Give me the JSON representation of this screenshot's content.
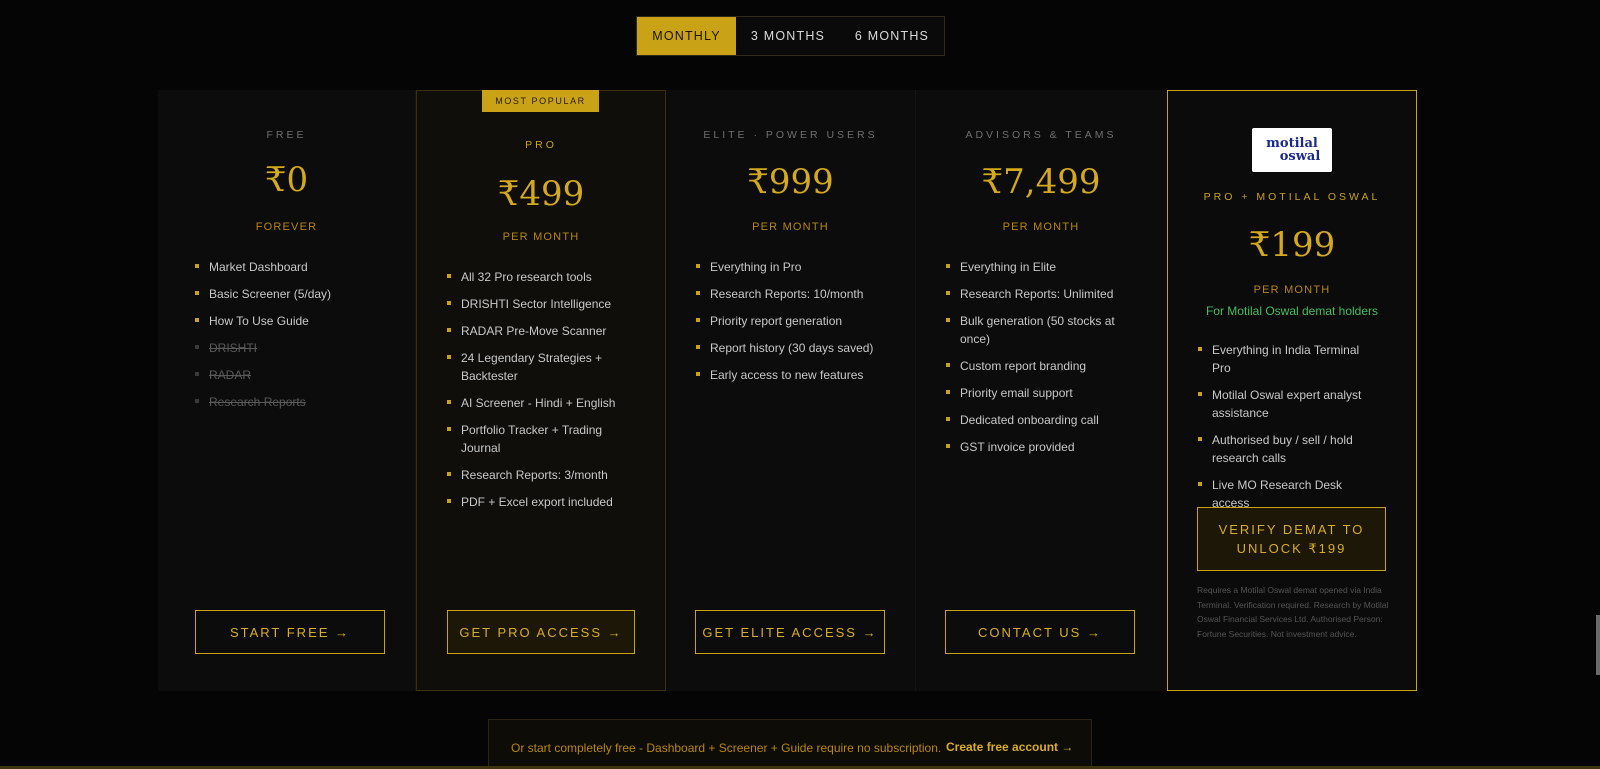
{
  "tabs": [
    {
      "label": "MONTHLY",
      "active": true
    },
    {
      "label": "3 MONTHS",
      "active": false
    },
    {
      "label": "6 MONTHS",
      "active": false
    }
  ],
  "plans": {
    "free": {
      "tier": "FREE",
      "price": "₹0",
      "period": "FOREVER",
      "features": [
        "Market Dashboard",
        "Basic Screener (5/day)",
        "How To Use Guide"
      ],
      "disabled_features": [
        "DRISHTI",
        "RADAR",
        "Research Reports"
      ],
      "button": "START FREE →"
    },
    "pro": {
      "badge": "MOST POPULAR",
      "tier": "PRO",
      "price": "₹499",
      "period": "PER MONTH",
      "features": [
        "All 32 Pro research tools",
        "DRISHTI Sector Intelligence",
        "RADAR Pre-Move Scanner",
        "24 Legendary Strategies + Backtester",
        "AI Screener - Hindi + English",
        "Portfolio Tracker + Trading Journal",
        "Research Reports: 3/month",
        "PDF + Excel export included"
      ],
      "button": "GET PRO ACCESS →"
    },
    "elite": {
      "tier": "ELITE · POWER USERS",
      "price": "₹999",
      "period": "PER MONTH",
      "features": [
        "Everything in Pro",
        "Research Reports: 10/month",
        "Priority report generation",
        "Report history (30 days saved)",
        "Early access to new features"
      ],
      "button": "GET ELITE ACCESS →"
    },
    "advisors": {
      "tier": "ADVISORS & TEAMS",
      "price": "₹7,499",
      "period": "PER MONTH",
      "features": [
        "Everything in Elite",
        "Research Reports: Unlimited",
        "Bulk generation (50 stocks at once)",
        "Custom report branding",
        "Priority email support",
        "Dedicated onboarding call",
        "GST invoice provided"
      ],
      "button": "CONTACT US →"
    },
    "motilal": {
      "logo_line1": "motilal",
      "logo_line2": "oswal",
      "tier": "PRO + MOTILAL OSWAL",
      "price": "₹199",
      "period": "PER MONTH",
      "note": "For Motilal Oswal demat holders",
      "features": [
        "Everything in India Terminal Pro",
        "Motilal Oswal expert analyst assistance",
        "Authorised buy / sell / hold research calls",
        "Live MO Research Desk access"
      ],
      "button_line1": "VERIFY DEMAT TO",
      "button_line2": "UNLOCK ₹199",
      "disclaimer": "Requires a Motilal Oswal demat opened via India Terminal. Verification required. Research by Motilal Oswal Financial Services Ltd. Authorised Person: Fortune Securities. Not investment advice."
    }
  },
  "footer": {
    "text": "Or start completely free - Dashboard + Screener + Guide require no subscription.",
    "link": "Create free account →"
  },
  "colors": {
    "accent": "#c9a215",
    "background": "#050505",
    "green": "#3fbf5f"
  }
}
